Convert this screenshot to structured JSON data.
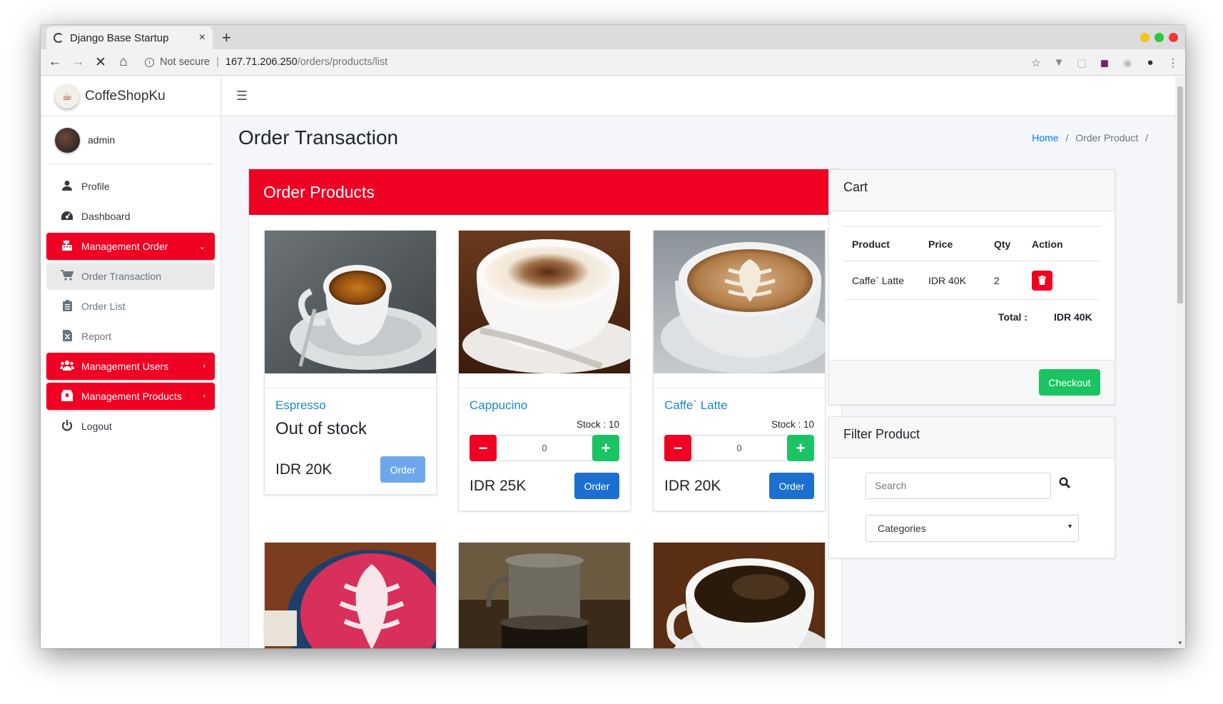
{
  "browser": {
    "tab_title": "Django Base Startup",
    "close_glyph": "×",
    "new_tab_glyph": "+",
    "security_label": "Not secure",
    "url_host": "167.71.206.250",
    "url_path": "/orders/products/list"
  },
  "brand": {
    "name": "CoffeShopKu",
    "logo_icon": "coffee-cup-icon"
  },
  "user": {
    "name": "admin"
  },
  "sidebar": {
    "items": [
      {
        "label": "Profile",
        "icon": "user-icon"
      },
      {
        "label": "Dashboard",
        "icon": "dashboard-icon"
      },
      {
        "label": "Management Order",
        "icon": "cash-register-icon",
        "caret": "⌄"
      },
      {
        "label": "Order Transaction",
        "icon": "cart-icon"
      },
      {
        "label": "Order List",
        "icon": "clipboard-icon"
      },
      {
        "label": "Report",
        "icon": "file-excel-icon"
      },
      {
        "label": "Management Users",
        "icon": "users-icon",
        "caret": "‹"
      },
      {
        "label": "Management Products",
        "icon": "box-icon",
        "caret": "‹"
      },
      {
        "label": "Logout",
        "icon": "power-icon"
      }
    ]
  },
  "header": {
    "title": "Order Transaction",
    "breadcrumb": {
      "home": "Home",
      "current": "Order Product",
      "sep": "/"
    }
  },
  "products": {
    "heading": "Order Products",
    "items": [
      {
        "name": "Espresso",
        "status": "Out of stock",
        "price": "IDR 20K",
        "order_label": "Order"
      },
      {
        "name": "Cappucino",
        "stock": "Stock : 10",
        "qty": "0",
        "price": "IDR 25K",
        "order_label": "Order"
      },
      {
        "name": "Caffe` Latte",
        "stock": "Stock : 10",
        "qty": "0",
        "price": "IDR 20K",
        "order_label": "Order"
      }
    ]
  },
  "cart": {
    "heading": "Cart",
    "columns": [
      "Product",
      "Price",
      "Qty",
      "Action"
    ],
    "rows": [
      {
        "product": "Caffe` Latte",
        "price": "IDR 40K",
        "qty": "2"
      }
    ],
    "total_label": "Total :",
    "total_value": "IDR 40K",
    "checkout_label": "Checkout"
  },
  "filter": {
    "heading": "Filter Product",
    "search_placeholder": "Search",
    "category_selected": "Categories"
  },
  "colors": {
    "primary_red": "#f00023",
    "success_green": "#1bc463",
    "primary_blue": "#1b6fd1",
    "link_blue": "#1e87c8"
  }
}
